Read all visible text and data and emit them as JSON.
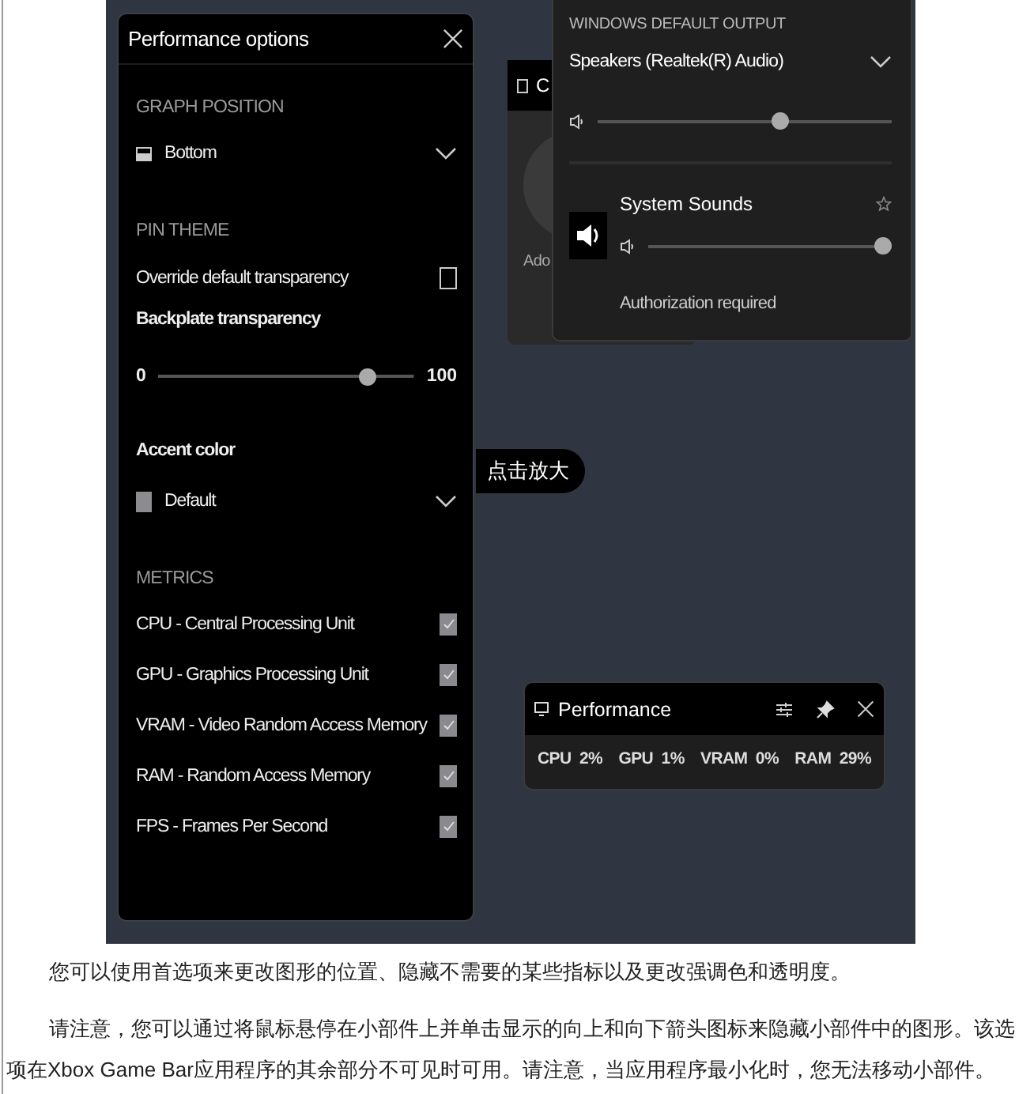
{
  "performance_options": {
    "title": "Performance options",
    "graph_position": {
      "heading": "GRAPH POSITION",
      "value": "Bottom"
    },
    "pin_theme": {
      "heading": "PIN THEME",
      "override": {
        "label": "Override default transparency",
        "checked": false
      },
      "backplate": {
        "label": "Backplate transparency",
        "min": "0",
        "max": "100",
        "level": 0.84
      },
      "accent": {
        "label": "Accent color",
        "value": "Default"
      }
    },
    "metrics": {
      "heading": "METRICS",
      "items": [
        {
          "label": "CPU - Central Processing Unit",
          "checked": true
        },
        {
          "label": "GPU - Graphics Processing Unit",
          "checked": true
        },
        {
          "label": "VRAM - Video Random Access Memory",
          "checked": true
        },
        {
          "label": "RAM - Random Access Memory",
          "checked": true
        },
        {
          "label": "FPS - Frames Per Second",
          "checked": true
        }
      ]
    }
  },
  "background_widget": {
    "title": "C",
    "text": "Ado"
  },
  "audio": {
    "heading": "WINDOWS DEFAULT OUTPUT",
    "device": "Speakers (Realtek(R) Audio)",
    "level": 0.63,
    "apps": [
      {
        "name": "System Sounds",
        "level": 1.0
      }
    ],
    "notice": "Authorization required"
  },
  "performance_widget": {
    "title": "Performance",
    "stats": [
      {
        "label": "CPU",
        "value": "2%"
      },
      {
        "label": "GPU",
        "value": "1%"
      },
      {
        "label": "VRAM",
        "value": "0%"
      },
      {
        "label": "RAM",
        "value": "29%"
      }
    ]
  },
  "zoom_hint": "点击放大",
  "paragraphs": [
    "您可以使用首选项来更改图形的位置、隐藏不需要的某些指标以及更改强调色和透明度。",
    "请注意，您可以通过将鼠标悬停在小部件上并单击显示的向上和向下箭头图标来隐藏小部件中的图形。该选项在Xbox Game Bar应用程序的其余部分不可见时可用。请注意，当应用程序最小化时，您无法移动小部件。"
  ]
}
